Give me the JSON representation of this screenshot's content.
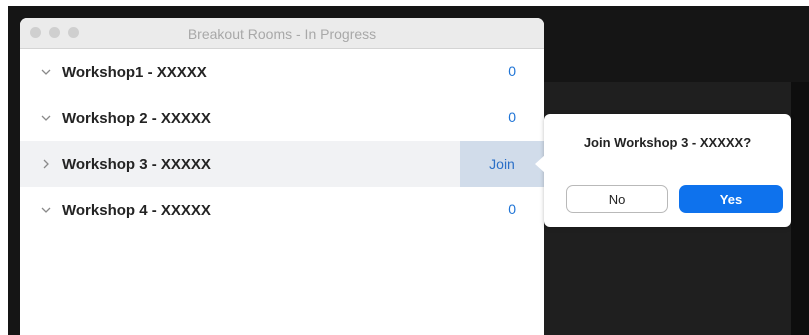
{
  "window": {
    "title": "Breakout Rooms - In Progress"
  },
  "rooms": [
    {
      "name": "Workshop1 - XXXXX",
      "count": "0",
      "expanded": true
    },
    {
      "name": "Workshop 2 - XXXXX",
      "count": "0",
      "expanded": true
    },
    {
      "name": "Workshop 3 - XXXXX",
      "action": "Join",
      "expanded": false,
      "selected": true
    },
    {
      "name": "Workshop 4 - XXXXX",
      "count": "0",
      "expanded": true
    }
  ],
  "popover": {
    "message": "Join Workshop 3 - XXXXX?",
    "no_label": "No",
    "yes_label": "Yes"
  },
  "colors": {
    "accent": "#0e72ed",
    "count_text": "#1f74d6",
    "selected_row": "#f1f2f4",
    "join_bg": "#d1dcea"
  },
  "icons": {
    "expanded": "chevron-down-icon",
    "collapsed": "chevron-right-icon"
  }
}
